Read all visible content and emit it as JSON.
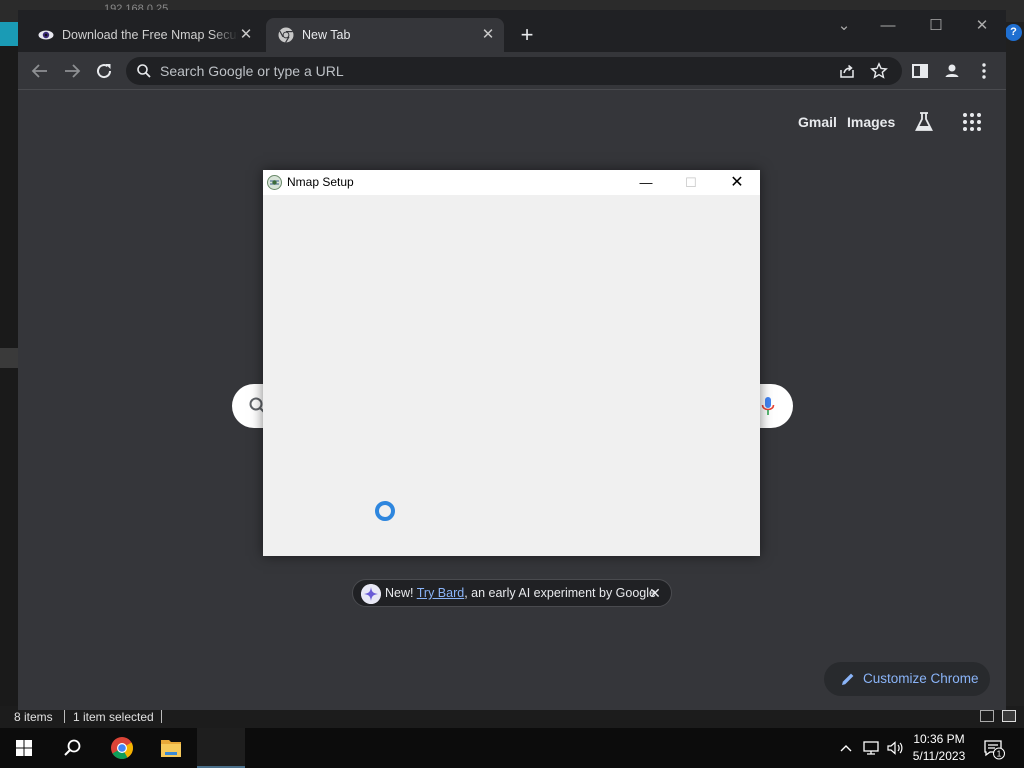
{
  "explorer": {
    "title_fragment": "192.168.0.25",
    "help": "?",
    "status_items": "8 items",
    "status_selected": "1 item selected"
  },
  "chrome": {
    "tabs": [
      {
        "title": "Download the Free Nmap Security Scanner",
        "close": "✕"
      },
      {
        "title": "New Tab",
        "close": "✕"
      }
    ],
    "new_tab": "+",
    "window_controls": {
      "tab_search": "⌄",
      "minimize": "—",
      "maximize": "☐",
      "close": "✕"
    },
    "omnibox_placeholder": "Search Google or type a URL"
  },
  "ntp": {
    "gmail": "Gmail",
    "images": "Images",
    "bard_prefix": "New! ",
    "bard_link": "Try Bard",
    "bard_suffix": ", an early AI experiment by Google",
    "bard_close": "✕",
    "customize_label": "Customize Chrome"
  },
  "dialog": {
    "title": "Nmap Setup",
    "minimize": "—",
    "maximize": "☐",
    "close": "✕"
  },
  "taskbar": {
    "time": "10:36 PM",
    "date": "5/11/2023",
    "notification_count": "1"
  },
  "colors": {
    "chrome_bg": "#35363a",
    "tabstrip_bg": "#202124",
    "link_blue": "#8ab4f8",
    "spinner": "#2e86de"
  }
}
